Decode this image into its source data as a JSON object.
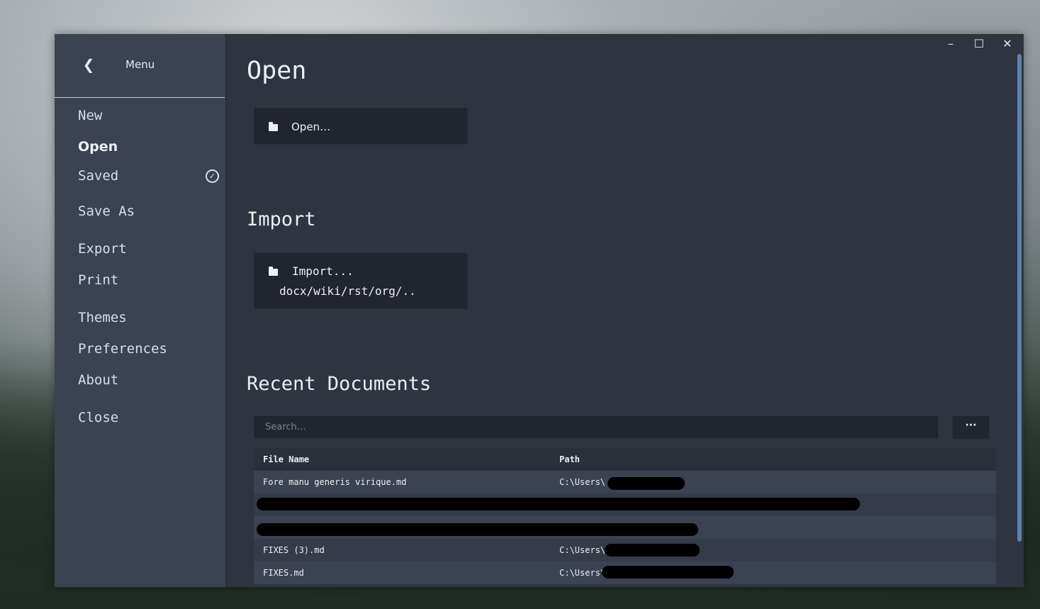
{
  "sidebar": {
    "title": "Menu",
    "items": [
      {
        "label": "New"
      },
      {
        "label": "Open",
        "active": true
      },
      {
        "label": "Saved",
        "status_icon": "check-circle-icon"
      },
      {
        "label": "Save As"
      },
      {
        "label": "Export"
      },
      {
        "label": "Print"
      },
      {
        "label": "Themes"
      },
      {
        "label": "Preferences"
      },
      {
        "label": "About"
      },
      {
        "label": "Close"
      }
    ]
  },
  "window_controls": {
    "minimize": "–",
    "maximize": "☐",
    "close": "✕"
  },
  "open_section": {
    "heading": "Open",
    "button_label": "Open…"
  },
  "import_section": {
    "heading": "Import",
    "button_label": "Import...",
    "button_sublabel": "docx/wiki/rst/org/.."
  },
  "recent": {
    "heading": "Recent Documents",
    "search_placeholder": "Search…",
    "more_label": "···",
    "columns": [
      "File Name",
      "Path"
    ],
    "rows": [
      {
        "name": "Fore manu generis virique.md",
        "path": "C:\\Users\\"
      },
      {
        "name": "",
        "path": ""
      },
      {
        "name": "",
        "path": ""
      },
      {
        "name": "FIXES (3).md",
        "path": "C:\\Users\\"
      },
      {
        "name": "FIXES.md",
        "path": "C:\\Users\\"
      }
    ]
  },
  "colors": {
    "sidebar_bg": "#3b4252",
    "content_bg": "#2e3440",
    "button_bg": "#21252d",
    "accent": "#5e81ac"
  }
}
